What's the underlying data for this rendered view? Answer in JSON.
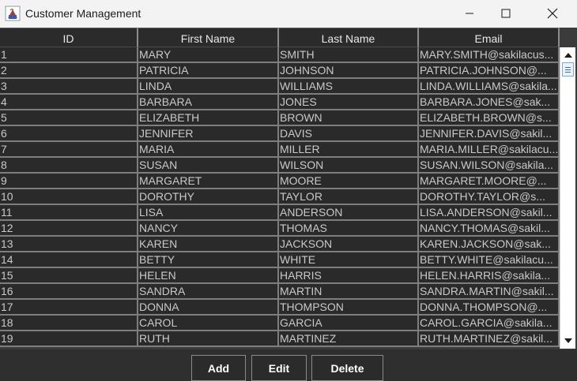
{
  "window": {
    "title": "Customer Management",
    "icon": "java-cup-icon"
  },
  "table": {
    "columns": [
      "ID",
      "First Name",
      "Last Name",
      "Email"
    ],
    "rows": [
      [
        "1",
        "MARY",
        "SMITH",
        "MARY.SMITH@sakilacus..."
      ],
      [
        "2",
        "PATRICIA",
        "JOHNSON",
        "PATRICIA.JOHNSON@..."
      ],
      [
        "3",
        "LINDA",
        "WILLIAMS",
        "LINDA.WILLIAMS@sakila..."
      ],
      [
        "4",
        "BARBARA",
        "JONES",
        "BARBARA.JONES@sak..."
      ],
      [
        "5",
        "ELIZABETH",
        "BROWN",
        "ELIZABETH.BROWN@s..."
      ],
      [
        "6",
        "JENNIFER",
        "DAVIS",
        "JENNIFER.DAVIS@sakil..."
      ],
      [
        "7",
        "MARIA",
        "MILLER",
        "MARIA.MILLER@sakilacu..."
      ],
      [
        "8",
        "SUSAN",
        "WILSON",
        "SUSAN.WILSON@sakila..."
      ],
      [
        "9",
        "MARGARET",
        "MOORE",
        "MARGARET.MOORE@..."
      ],
      [
        "10",
        "DOROTHY",
        "TAYLOR",
        "DOROTHY.TAYLOR@s..."
      ],
      [
        "11",
        "LISA",
        "ANDERSON",
        "LISA.ANDERSON@sakil..."
      ],
      [
        "12",
        "NANCY",
        "THOMAS",
        "NANCY.THOMAS@sakil..."
      ],
      [
        "13",
        "KAREN",
        "JACKSON",
        "KAREN.JACKSON@sak..."
      ],
      [
        "14",
        "BETTY",
        "WHITE",
        "BETTY.WHITE@sakilacu..."
      ],
      [
        "15",
        "HELEN",
        "HARRIS",
        "HELEN.HARRIS@sakila..."
      ],
      [
        "16",
        "SANDRA",
        "MARTIN",
        "SANDRA.MARTIN@sakil..."
      ],
      [
        "17",
        "DONNA",
        "THOMPSON",
        "DONNA.THOMPSON@..."
      ],
      [
        "18",
        "CAROL",
        "GARCIA",
        "CAROL.GARCIA@sakila..."
      ],
      [
        "19",
        "RUTH",
        "MARTINEZ",
        "RUTH.MARTINEZ@sakil..."
      ]
    ]
  },
  "buttons": {
    "add_label": "Add",
    "edit_label": "Edit",
    "delete_label": "Delete"
  },
  "colors": {
    "table_background": "#2a2a2a",
    "grid_line": "#7e7e7e",
    "cell_text": "#c9c9c9",
    "header_text": "#e8e8e8"
  }
}
